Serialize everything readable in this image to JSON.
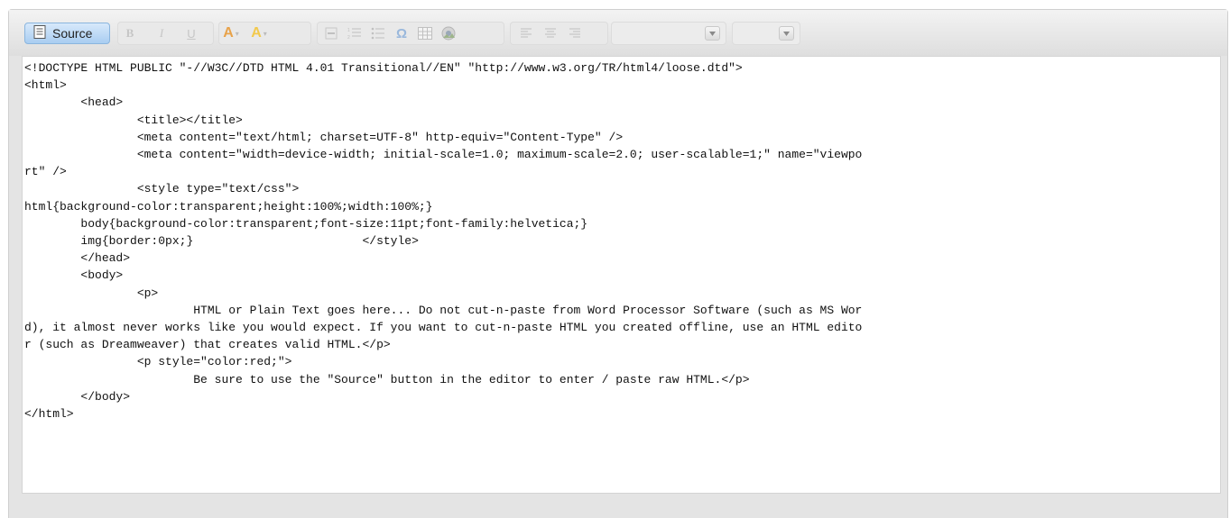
{
  "toolbar": {
    "source_label": "Source",
    "bold_label": "B",
    "italic_label": "I",
    "underline_label": "U",
    "font_color_label": "A",
    "bg_color_label": "A",
    "omega_label": "Ω",
    "format_value": "",
    "size_value": ""
  },
  "icons": [
    "source-icon",
    "bold-icon",
    "italic-icon",
    "underline-icon",
    "text-color-icon",
    "background-color-icon",
    "horizontal-rule-icon",
    "numbered-list-icon",
    "bulleted-list-icon",
    "special-char-icon",
    "table-icon",
    "image-icon",
    "align-left-icon",
    "align-center-icon",
    "align-right-icon",
    "chevron-down-icon"
  ],
  "colors": {
    "source_bg": "#a9cdf1",
    "text_color_icon": "#e8a24a",
    "bg_color_icon": "#f2c94c",
    "editor_bg": "#e4e4e4",
    "code_text": "#111111"
  },
  "editor": {
    "code": "<!DOCTYPE HTML PUBLIC \"-//W3C//DTD HTML 4.01 Transitional//EN\" \"http://www.w3.org/TR/html4/loose.dtd\">\n<html>\n\t<head>\n\t\t<title></title>\n\t\t<meta content=\"text/html; charset=UTF-8\" http-equiv=\"Content-Type\" />\n\t\t<meta content=\"width=device-width; initial-scale=1.0; maximum-scale=2.0; user-scalable=1;\" name=\"viewpo\nrt\" />\n\t\t<style type=\"text/css\">\nhtml{background-color:transparent;height:100%;width:100%;}\n\tbody{background-color:transparent;font-size:11pt;font-family:helvetica;}\n\timg{border:0px;}\t\t\t</style>\n\t</head>\n\t<body>\n\t\t<p>\n\t\t\tHTML or Plain Text goes here... Do not cut-n-paste from Word Processor Software (such as MS Wor\nd), it almost never works like you would expect. If you want to cut-n-paste HTML you created offline, use an HTML edito\nr (such as Dreamweaver) that creates valid HTML.</p>\n\t\t<p style=\"color:red;\">\n\t\t\tBe sure to use the \"Source\" button in the editor to enter / paste raw HTML.</p>\n\t</body>\n</html>"
  }
}
